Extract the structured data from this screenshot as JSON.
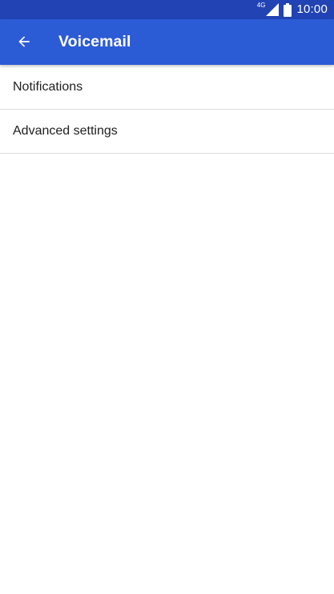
{
  "status_bar": {
    "network_type": "4G",
    "time": "10:00",
    "icons": [
      "signal-icon",
      "battery-icon"
    ]
  },
  "app_bar": {
    "back_icon": "arrow-left-icon",
    "title": "Voicemail"
  },
  "settings": {
    "items": [
      {
        "label": "Notifications"
      },
      {
        "label": "Advanced settings"
      }
    ]
  },
  "colors": {
    "status_bar": "#2143b3",
    "app_bar": "#2c5bd6",
    "divider": "#dcdcdc",
    "text": "#212121"
  }
}
